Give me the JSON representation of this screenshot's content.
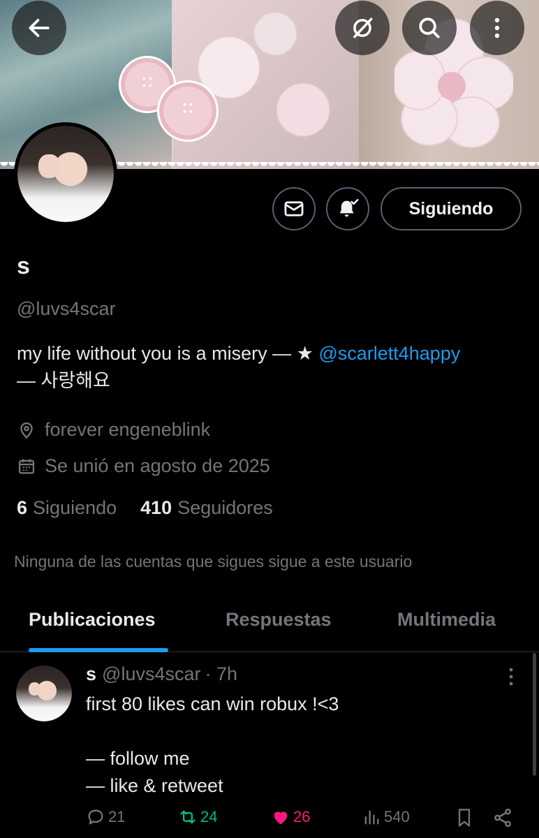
{
  "header": {
    "back_icon": "arrow-left-icon",
    "grok_icon": "grok-icon",
    "search_icon": "search-icon",
    "more_icon": "more-vertical-icon"
  },
  "profile": {
    "name": "s",
    "handle": "@luvs4scar",
    "bio_text": "my life without you is a misery — ★ ",
    "bio_mention": "@scarlett4happy",
    "bio_line2": "— 사랑해요",
    "location": "forever engeneblink",
    "joined": "Se unió en agosto de 2025",
    "following_count": "6",
    "following_label": "Siguiendo",
    "followers_count": "410",
    "followers_label": "Seguidores",
    "mutuals_note": "Ninguna de las cuentas que sigues sigue a este usuario",
    "follow_button_label": "Siguiendo"
  },
  "tabs": [
    {
      "label": "Publicaciones",
      "active": true
    },
    {
      "label": "Respuestas",
      "active": false
    },
    {
      "label": "Multimedia",
      "active": false
    }
  ],
  "post": {
    "name": "s",
    "handle": "@luvs4scar",
    "time": "· 7h",
    "text": "first 80 likes can win robux !<3\n\n— follow me\n— like & retweet",
    "replies": "21",
    "reposts": "24",
    "likes": "26",
    "views": "540"
  },
  "colors": {
    "accent": "#1d9bf0",
    "repost": "#00ba7c",
    "like": "#f91880",
    "muted": "#71767b"
  }
}
